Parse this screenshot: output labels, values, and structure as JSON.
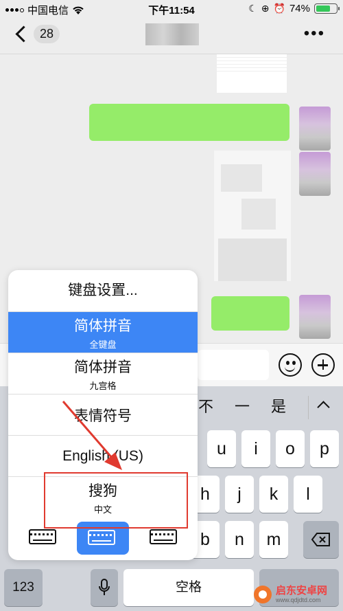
{
  "status_bar": {
    "carrier": "中国电信",
    "time": "下午11:54",
    "battery_percent": "74%",
    "battery_level": 0.74
  },
  "nav": {
    "unread_count": "28"
  },
  "input_menu": {
    "header": "键盘设置...",
    "items": [
      {
        "main": "简体拼音",
        "sub": "全键盘",
        "selected": true
      },
      {
        "main": "简体拼音",
        "sub": "九宫格",
        "selected": false
      },
      {
        "main": "表情符号",
        "sub": "",
        "selected": false
      },
      {
        "main": "English (US)",
        "sub": "",
        "selected": false
      },
      {
        "main": "搜狗",
        "sub": "中文",
        "selected": false
      }
    ]
  },
  "keyboard": {
    "candidates": [
      "不",
      "一",
      "是"
    ],
    "row1": [
      "u",
      "i",
      "o",
      "p"
    ],
    "row2": [
      "h",
      "j",
      "k",
      "l"
    ],
    "row3": [
      "b",
      "n",
      "m"
    ],
    "numbers_label": "123",
    "space_label": "空格"
  },
  "colors": {
    "selected_blue": "#3d86f5",
    "highlight_red": "#e03a2f",
    "bubble_green": "#95ec69"
  },
  "watermark": {
    "title": "启东安卓网",
    "url": "www.qdjdtd.com"
  }
}
